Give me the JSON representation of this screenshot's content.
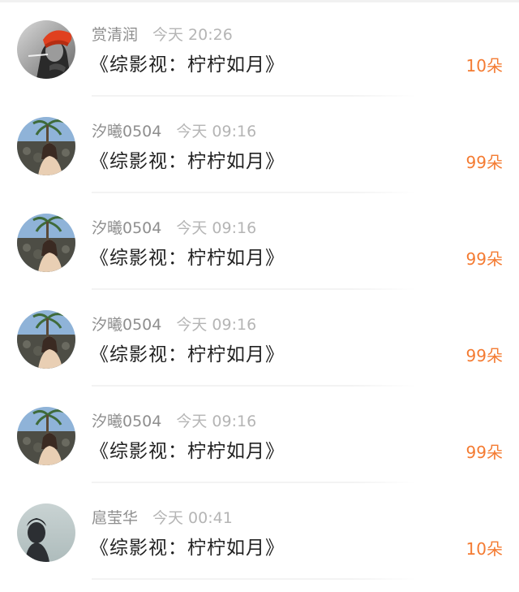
{
  "gifts": [
    {
      "avatar_icon": "avatar-woman-red-hat-icon",
      "username": "赏清润",
      "time": "今天 20:26",
      "message": "《综影视：柠柠如月》",
      "count": "10朵"
    },
    {
      "avatar_icon": "avatar-woman-palm-tree-icon",
      "username": "汐曦0504",
      "time": "今天 09:16",
      "message": "《综影视：柠柠如月》",
      "count": "99朵"
    },
    {
      "avatar_icon": "avatar-woman-palm-tree-icon",
      "username": "汐曦0504",
      "time": "今天 09:16",
      "message": "《综影视：柠柠如月》",
      "count": "99朵"
    },
    {
      "avatar_icon": "avatar-woman-palm-tree-icon",
      "username": "汐曦0504",
      "time": "今天 09:16",
      "message": "《综影视：柠柠如月》",
      "count": "99朵"
    },
    {
      "avatar_icon": "avatar-woman-palm-tree-icon",
      "username": "汐曦0504",
      "time": "今天 09:16",
      "message": "《综影视：柠柠如月》",
      "count": "99朵"
    },
    {
      "avatar_icon": "avatar-silhouette-icon",
      "username": "扈莹华",
      "time": "今天 00:41",
      "message": "《综影视：柠柠如月》",
      "count": "10朵"
    }
  ],
  "colors": {
    "username": "#8e8e8e",
    "time": "#b5b5b5",
    "message": "#222222",
    "count_accent": "#f47b32",
    "divider": "#f3f3f3"
  }
}
